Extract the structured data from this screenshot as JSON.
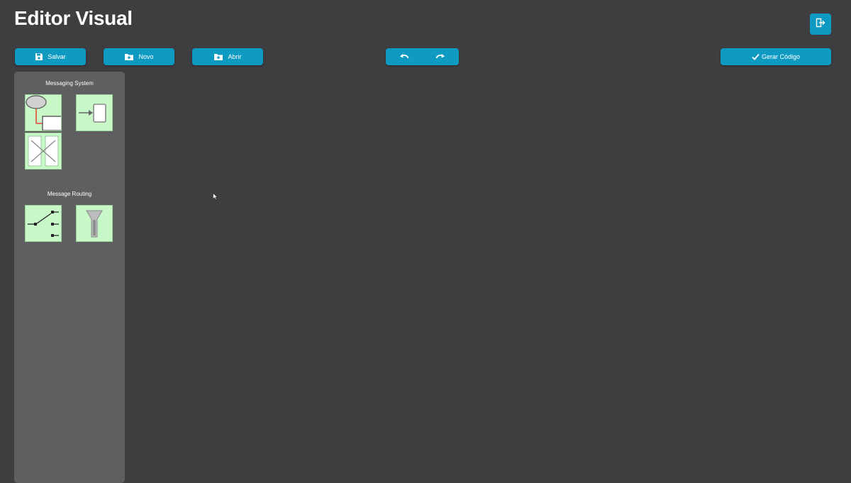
{
  "app": {
    "title": "Editor Visual"
  },
  "header": {
    "exit_icon": "logout-icon"
  },
  "toolbar": {
    "save_label": "Salvar",
    "save_icon": "floppy-disk-icon",
    "new_label": "Novo",
    "new_icon": "folder-plus-icon",
    "open_label": "Abrir",
    "open_icon": "folder-open-icon",
    "undo_icon": "undo-icon",
    "redo_icon": "redo-icon",
    "generate_label": "Gerar Código",
    "generate_icon": "check-icon"
  },
  "palette": {
    "sections": [
      {
        "label": "Messaging System",
        "items": [
          {
            "icon": "message-channel-icon"
          },
          {
            "icon": "message-endpoint-icon"
          },
          {
            "icon": "channel-crossover-icon"
          }
        ]
      },
      {
        "label": "Message Routing",
        "items": [
          {
            "icon": "content-router-icon"
          },
          {
            "icon": "message-filter-icon"
          }
        ]
      }
    ]
  },
  "colors": {
    "background": "#3e3d3f",
    "accent": "#0f9ac2",
    "palette_background": "#5f5e60",
    "tile_background": "#c8f7c8"
  }
}
